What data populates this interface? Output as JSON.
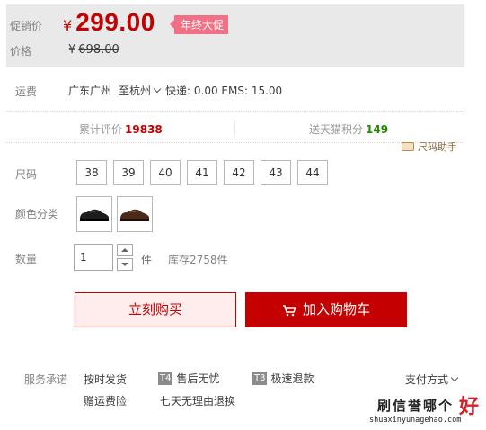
{
  "price": {
    "promo_label": "促销价",
    "currency": "¥",
    "promo_value": "299.00",
    "badge": "年终大促",
    "orig_label": "价格",
    "orig_value": "698.00"
  },
  "shipping": {
    "label": "运费",
    "from": "广东广州",
    "to": "至杭州",
    "fee": "快递: 0.00 EMS: 15.00"
  },
  "stats": {
    "review_label": "累计评价",
    "review_count": "19838",
    "points_label": "送天猫积分",
    "points_value": "149",
    "size_helper": "尺码助手"
  },
  "size": {
    "label": "尺码",
    "options": [
      "38",
      "39",
      "40",
      "41",
      "42",
      "43",
      "44"
    ]
  },
  "color": {
    "label": "颜色分类",
    "options": [
      "black-shoe",
      "brown-shoe"
    ]
  },
  "quantity": {
    "label": "数量",
    "value": "1",
    "unit": "件",
    "stock": "库存2758件"
  },
  "actions": {
    "buy_now": "立刻购买",
    "add_cart": "加入购物车"
  },
  "services": {
    "label": "服务承诺",
    "items": [
      {
        "tag": "",
        "text": "按时发货"
      },
      {
        "tag": "T4",
        "text": "售后无忧"
      },
      {
        "tag": "T3",
        "text": "极速退款"
      },
      {
        "tag": "",
        "text": "赠运费险"
      },
      {
        "tag": "",
        "text": "七天无理由退换"
      }
    ],
    "payment": "支付方式"
  },
  "watermark": {
    "main": "刷信誉哪个",
    "big": "好",
    "sub": "shuaxinyunagehao.com"
  },
  "colors": {
    "accent": "#c40000",
    "badge": "#f07086",
    "points": "#228800"
  }
}
